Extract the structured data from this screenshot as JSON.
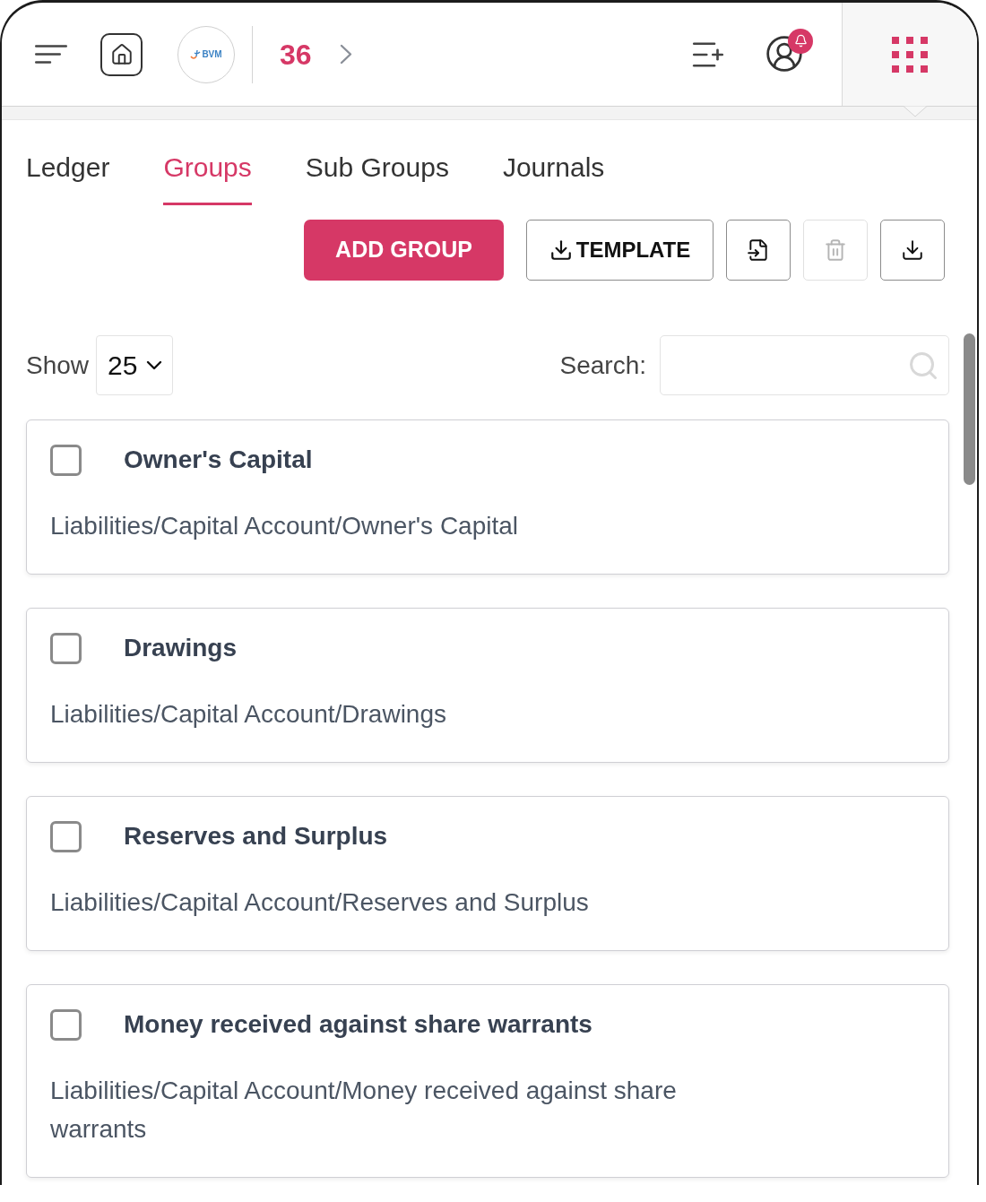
{
  "header": {
    "logo_text": "BVM",
    "count": "36"
  },
  "tabs": [
    {
      "label": "Ledger",
      "selected": false
    },
    {
      "label": "Groups",
      "selected": true
    },
    {
      "label": "Sub Groups",
      "selected": false
    },
    {
      "label": "Journals",
      "selected": false
    }
  ],
  "actions": {
    "add_button": "ADD GROUP",
    "template_button": "TEMPLATE",
    "icon_buttons": [
      {
        "disabled": false
      },
      {
        "disabled": true
      },
      {
        "disabled": false
      }
    ]
  },
  "page_length": {
    "label": "Show",
    "value": "25"
  },
  "search": {
    "label": "Search:"
  },
  "groups": [
    {
      "name": "Owner's Capital",
      "path": "Liabilities/Capital Account/Owner's Capital",
      "checked": false
    },
    {
      "name": "Drawings",
      "path": "Liabilities/Capital Account/Drawings",
      "checked": false
    },
    {
      "name": "Reserves and Surplus",
      "path": "Liabilities/Capital Account/Reserves and Surplus",
      "checked": false
    },
    {
      "name": "Money received against share warrants",
      "path": "Liabilities/Capital Account/Money received against share warrants",
      "checked": false
    }
  ]
}
